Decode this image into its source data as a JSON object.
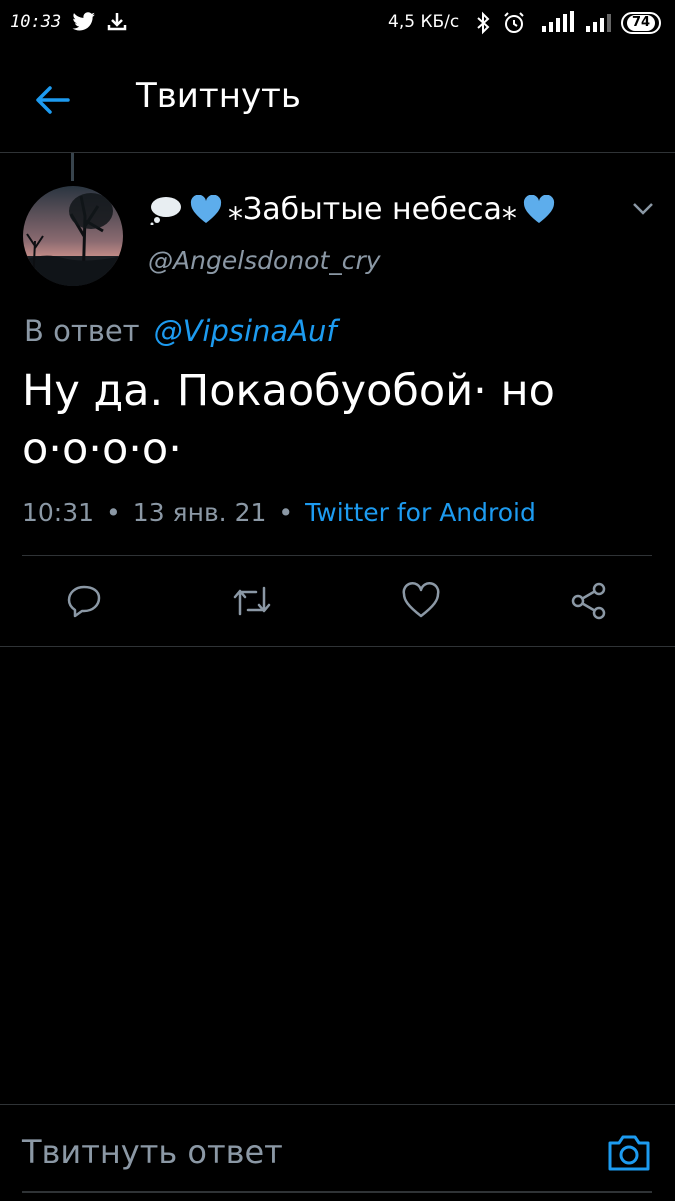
{
  "status_bar": {
    "time": "10:33",
    "net_speed": "4,5 КБ/с",
    "battery": "74",
    "icons": [
      "twitter-bird-icon",
      "download-icon",
      "bluetooth-icon",
      "alarm-icon",
      "signal-icon",
      "signal-icon"
    ]
  },
  "header": {
    "title": "Твитнуть",
    "back_icon": "arrow-left-icon"
  },
  "tweet": {
    "display_name": "⁎Забытые небеса⁎",
    "handle": "@Angelsdonot_cry",
    "reply_prefix": "В ответ",
    "reply_to": "@VipsinaAuf",
    "text": "Ну да. Покаобуобой· но о·о·о·о·",
    "time": "10:31",
    "date": "13 янв. 21",
    "source": "Twitter for Android"
  },
  "actions": [
    "reply-icon",
    "retweet-icon",
    "like-icon",
    "share-icon"
  ],
  "reply_bar": {
    "placeholder": "Твитнуть ответ",
    "camera_icon": "camera-icon"
  },
  "colors": {
    "background": "#000000",
    "accent": "#1d9bf0",
    "secondary_text": "#8b98a5",
    "divider": "#2f3336"
  }
}
